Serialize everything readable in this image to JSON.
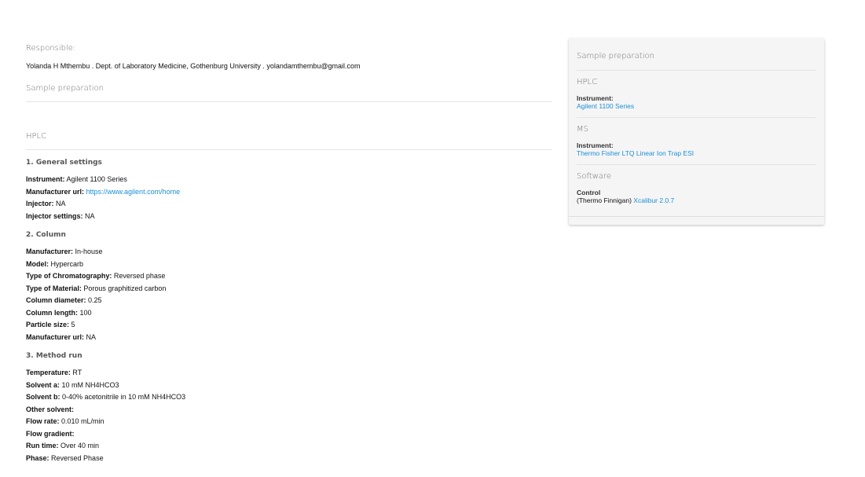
{
  "responsible": {
    "label": "Responsible:",
    "text": "Yolanda H Mthembu . Dept. of Laboratory Medicine, Gothenburg University . yolandamthembu@gmail.com"
  },
  "main": {
    "sample_preparation_heading": "Sample preparation",
    "hplc_heading": "HPLC",
    "general_settings": {
      "title": "1. General settings",
      "instrument_label": "Instrument:",
      "instrument_value": "Agilent 1100 Series",
      "manufacturer_url_label": "Manufacturer url:",
      "manufacturer_url_value": "https://www.agilent.com/home",
      "injector_label": "Injector:",
      "injector_value": "NA",
      "injector_settings_label": "Injector settings:",
      "injector_settings_value": "NA"
    },
    "column": {
      "title": "2. Column",
      "fields": [
        {
          "label": "Manufacturer:",
          "value": "In-house"
        },
        {
          "label": "Model:",
          "value": "Hypercarb"
        },
        {
          "label": "Type of Chromatography:",
          "value": "Reversed phase"
        },
        {
          "label": "Type of Material:",
          "value": "Porous graphitized carbon"
        },
        {
          "label": "Column diameter:",
          "value": "0.25"
        },
        {
          "label": "Column length:",
          "value": "100"
        },
        {
          "label": "Particle size:",
          "value": "5"
        },
        {
          "label": "Manufacturer url:",
          "value": "NA"
        }
      ]
    },
    "method_run": {
      "title": "3. Method run",
      "fields": [
        {
          "label": "Temperature:",
          "value": "RT"
        },
        {
          "label": "Solvent a:",
          "value": "10 mM NH4HCO3"
        },
        {
          "label": "Solvent b:",
          "value": "0-40% acetonitrile in 10 mM NH4HCO3"
        },
        {
          "label": "Other solvent:",
          "value": ""
        },
        {
          "label": "Flow rate:",
          "value": "0.010 mL/min"
        },
        {
          "label": "Flow gradient:",
          "value": ""
        },
        {
          "label": "Run time:",
          "value": "Over 40 min"
        },
        {
          "label": "Phase:",
          "value": "Reversed Phase"
        }
      ]
    }
  },
  "sidebar": {
    "title": "Sample preparation",
    "hplc": {
      "heading": "HPLC",
      "instrument_label": "Instrument:",
      "instrument_link": "Agilent 1100 Series"
    },
    "ms": {
      "heading": "MS",
      "instrument_label": "Instrument:",
      "instrument_link": "Thermo Fisher LTQ Linear Ion Trap ESI"
    },
    "software": {
      "heading": "Software",
      "control_label": "Control",
      "control_prefix": "(Thermo Finnigan)",
      "control_link": "Xcalibur 2.0.7"
    }
  },
  "colors": {
    "link": "#1a8fd6",
    "heading_gray": "#6f6f6f",
    "sidebar_bg": "#f5f5f5"
  }
}
